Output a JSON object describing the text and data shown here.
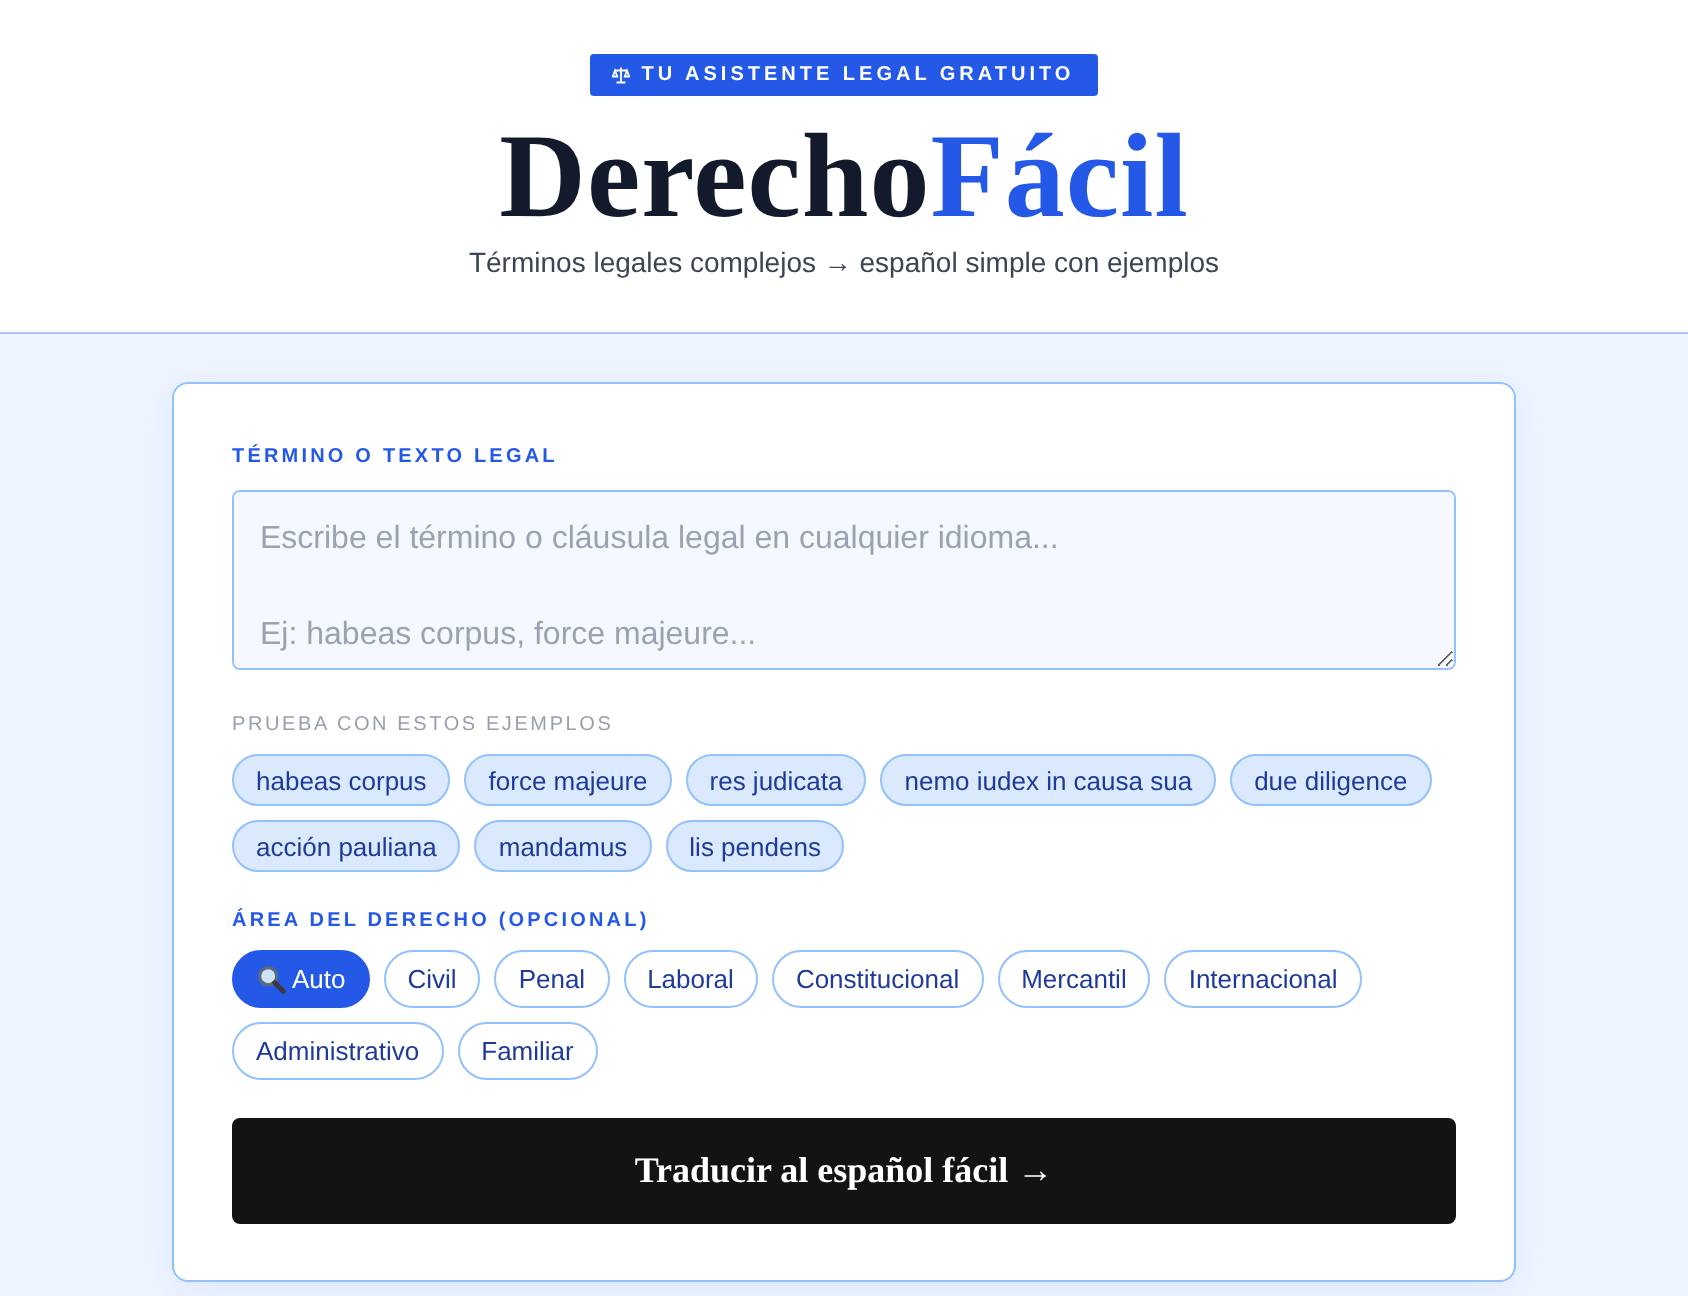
{
  "header": {
    "badge": "TU ASISTENTE LEGAL GRATUITO",
    "title": {
      "main": "Derecho",
      "accent": "Fácil"
    },
    "subtitle": "Términos legales complejos → español simple con ejemplos"
  },
  "form": {
    "term_label": "TÉRMINO O TEXTO LEGAL",
    "term_field": {
      "placeholder": "Escribe el término o cláusula legal en cualquier idioma...\n\nEj: habeas corpus, force majeure..."
    },
    "examples_label": "PRUEBA CON ESTOS EJEMPLOS",
    "examples": [
      "habeas corpus",
      "force majeure",
      "res judicata",
      "nemo iudex in causa sua",
      "due diligence",
      "acción pauliana",
      "mandamus",
      "lis pendens"
    ],
    "area_label": "ÁREA DEL DERECHO (OPCIONAL)",
    "areas": [
      {
        "kind": "auto",
        "label": "Auto",
        "selected": true
      },
      {
        "kind": "area",
        "label": "Civil",
        "selected": false
      },
      {
        "kind": "area",
        "label": "Penal",
        "selected": false
      },
      {
        "kind": "area",
        "label": "Laboral",
        "selected": false
      },
      {
        "kind": "area",
        "label": "Constitucional",
        "selected": false
      },
      {
        "kind": "area",
        "label": "Mercantil",
        "selected": false
      },
      {
        "kind": "area",
        "label": "Internacional",
        "selected": false
      },
      {
        "kind": "area",
        "label": "Administrativo",
        "selected": false
      },
      {
        "kind": "area",
        "label": "Familiar",
        "selected": false
      }
    ],
    "submit": "Traducir al español fácil →"
  }
}
